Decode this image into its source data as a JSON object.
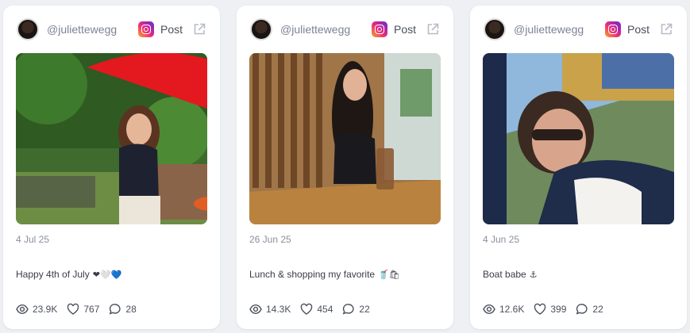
{
  "posts": [
    {
      "username": "@juliettewegg",
      "post_label": "Post",
      "date": "4 Jul 25",
      "caption": "Happy 4th of July",
      "caption_emoji": "❤🤍💙",
      "views": "23.9K",
      "likes": "767",
      "comments": "28"
    },
    {
      "username": "@juliettewegg",
      "post_label": "Post",
      "date": "26 Jun 25",
      "caption": "Lunch & shopping my favorite",
      "caption_emoji": "🥤🛍",
      "views": "14.3K",
      "likes": "454",
      "comments": "22"
    },
    {
      "username": "@juliettewegg",
      "post_label": "Post",
      "date": "4 Jun 25",
      "caption": "Boat babe",
      "caption_emoji": "⚓",
      "views": "12.6K",
      "likes": "399",
      "comments": "22"
    }
  ],
  "icons": {
    "platform": "instagram-icon",
    "external": "external-link-icon",
    "views": "eye-icon",
    "likes": "heart-icon",
    "comments": "comment-icon"
  }
}
